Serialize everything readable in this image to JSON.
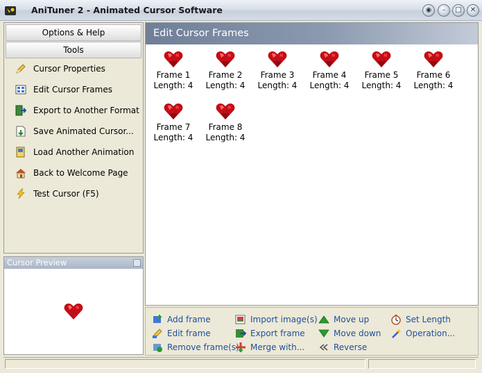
{
  "window": {
    "title": "AniTuner 2 - Animated Cursor Software",
    "controls": [
      "help-icon",
      "minimize-icon",
      "maximize-icon",
      "close-icon"
    ]
  },
  "sidebar": {
    "tabs": [
      {
        "label": "Options & Help"
      },
      {
        "label": "Tools"
      }
    ],
    "items": [
      {
        "label": "Cursor Properties",
        "icon": "pencil-icon"
      },
      {
        "label": "Edit Cursor Frames",
        "icon": "frames-icon"
      },
      {
        "label": "Export to Another Format",
        "icon": "export-icon"
      },
      {
        "label": "Save Animated Cursor...",
        "icon": "save-icon"
      },
      {
        "label": "Load Another Animation",
        "icon": "load-icon"
      },
      {
        "label": "Back to Welcome Page",
        "icon": "home-icon"
      },
      {
        "label": "Test Cursor (F5)",
        "icon": "lightning-icon"
      }
    ]
  },
  "preview": {
    "title": "Cursor Preview"
  },
  "main": {
    "title": "Edit Cursor Frames",
    "frames": [
      {
        "name": "Frame 1",
        "length": "Length: 4"
      },
      {
        "name": "Frame 2",
        "length": "Length: 4"
      },
      {
        "name": "Frame 3",
        "length": "Length: 4"
      },
      {
        "name": "Frame 4",
        "length": "Length: 4"
      },
      {
        "name": "Frame 5",
        "length": "Length: 4"
      },
      {
        "name": "Frame 6",
        "length": "Length: 4"
      },
      {
        "name": "Frame 7",
        "length": "Length: 4"
      },
      {
        "name": "Frame 8",
        "length": "Length: 4"
      }
    ]
  },
  "actions": {
    "add_frame": "Add frame",
    "edit_frame": "Edit frame",
    "remove_frame": "Remove frame(s)",
    "import_images": "Import image(s)",
    "export_frame": "Export frame",
    "merge_with": "Merge with...",
    "move_up": "Move up",
    "move_down": "Move down",
    "reverse": "Reverse",
    "set_length": "Set Length",
    "operation": "Operation..."
  },
  "colors": {
    "heart": "#c40d16",
    "link": "#1f4f9c",
    "header": "#7b8aa3"
  }
}
